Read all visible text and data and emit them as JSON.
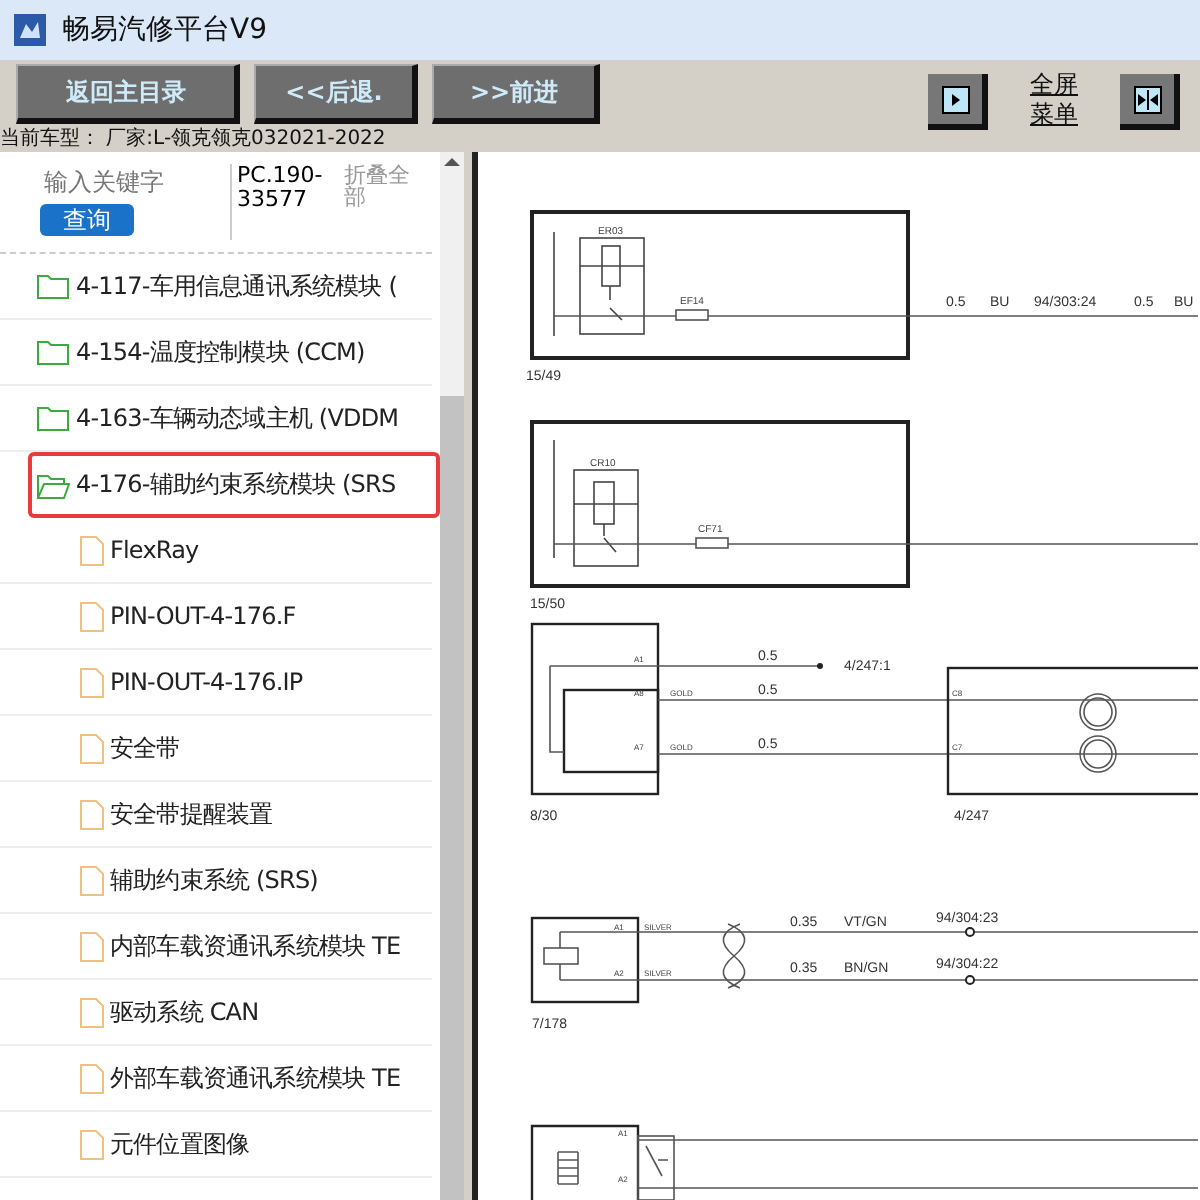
{
  "window": {
    "title": "畅易汽修平台V9"
  },
  "toolbar": {
    "buttons": [
      "返回主目录",
      "<<后退.",
      ">>前进"
    ],
    "fullscreen_menu": [
      "全屏",
      "菜单"
    ]
  },
  "vehicle": "当前车型： 厂家:L-领克领克032021-2022",
  "search": {
    "placeholder": "输入关键字",
    "button": "查询",
    "code": "PC.190-33577",
    "collapse_all": "折叠全部"
  },
  "tree": [
    {
      "label": "4-117-车用信息通讯系统模块 (",
      "kind": "folder",
      "selected": false,
      "expanded": false
    },
    {
      "label": "4-154-温度控制模块 (CCM)",
      "kind": "folder",
      "selected": false,
      "expanded": false
    },
    {
      "label": "4-163-车辆动态域主机 (VDDM",
      "kind": "folder",
      "selected": false,
      "expanded": false
    },
    {
      "label": "4-176-辅助约束系统模块 (SRS",
      "kind": "folder",
      "selected": true,
      "expanded": true,
      "children": [
        {
          "label": "FlexRay",
          "kind": "file"
        },
        {
          "label": "PIN-OUT-4-176.F",
          "kind": "file"
        },
        {
          "label": "PIN-OUT-4-176.IP",
          "kind": "file"
        },
        {
          "label": "安全带",
          "kind": "file"
        },
        {
          "label": "安全带提醒装置",
          "kind": "file"
        },
        {
          "label": "辅助约束系统 (SRS)",
          "kind": "file"
        },
        {
          "label": "内部车载资通讯系统模块 TE",
          "kind": "file"
        },
        {
          "label": "驱动系统 CAN",
          "kind": "file"
        },
        {
          "label": "外部车载资通讯系统模块 TE",
          "kind": "file"
        },
        {
          "label": "元件位置图像",
          "kind": "file"
        }
      ]
    }
  ],
  "diagram": {
    "relay_1": {
      "name": "ER03",
      "fuse": "EF14",
      "connector": "15/49",
      "wire": [
        "0.5",
        "BU",
        "94/303:24",
        "0.5",
        "BU"
      ]
    },
    "relay_2": {
      "name": "CR10",
      "fuse": "CF71",
      "connector": "15/50"
    },
    "module": {
      "connector": "8/30",
      "pins": [
        "A1",
        "A8",
        "A7"
      ],
      "pin_colors": [
        "GOLD",
        "GOLD"
      ],
      "wire_sizes": [
        "0.5",
        "0.5",
        "0.5"
      ],
      "splice": "4/247:1"
    },
    "clockspring": {
      "connector": "4/247",
      "pins": [
        "C8",
        "C7"
      ]
    },
    "sensor": {
      "connector": "7/178",
      "pins": [
        "A1",
        "A2"
      ],
      "pin_colors": [
        "SILVER",
        "SILVER"
      ],
      "wires": [
        {
          "size": "0.35",
          "code": "VT/GN",
          "splice": "94/304:23"
        },
        {
          "size": "0.35",
          "code": "BN/GN",
          "splice": "94/304:22"
        }
      ]
    },
    "switch": {
      "pins": [
        "A1",
        "A2"
      ]
    }
  }
}
